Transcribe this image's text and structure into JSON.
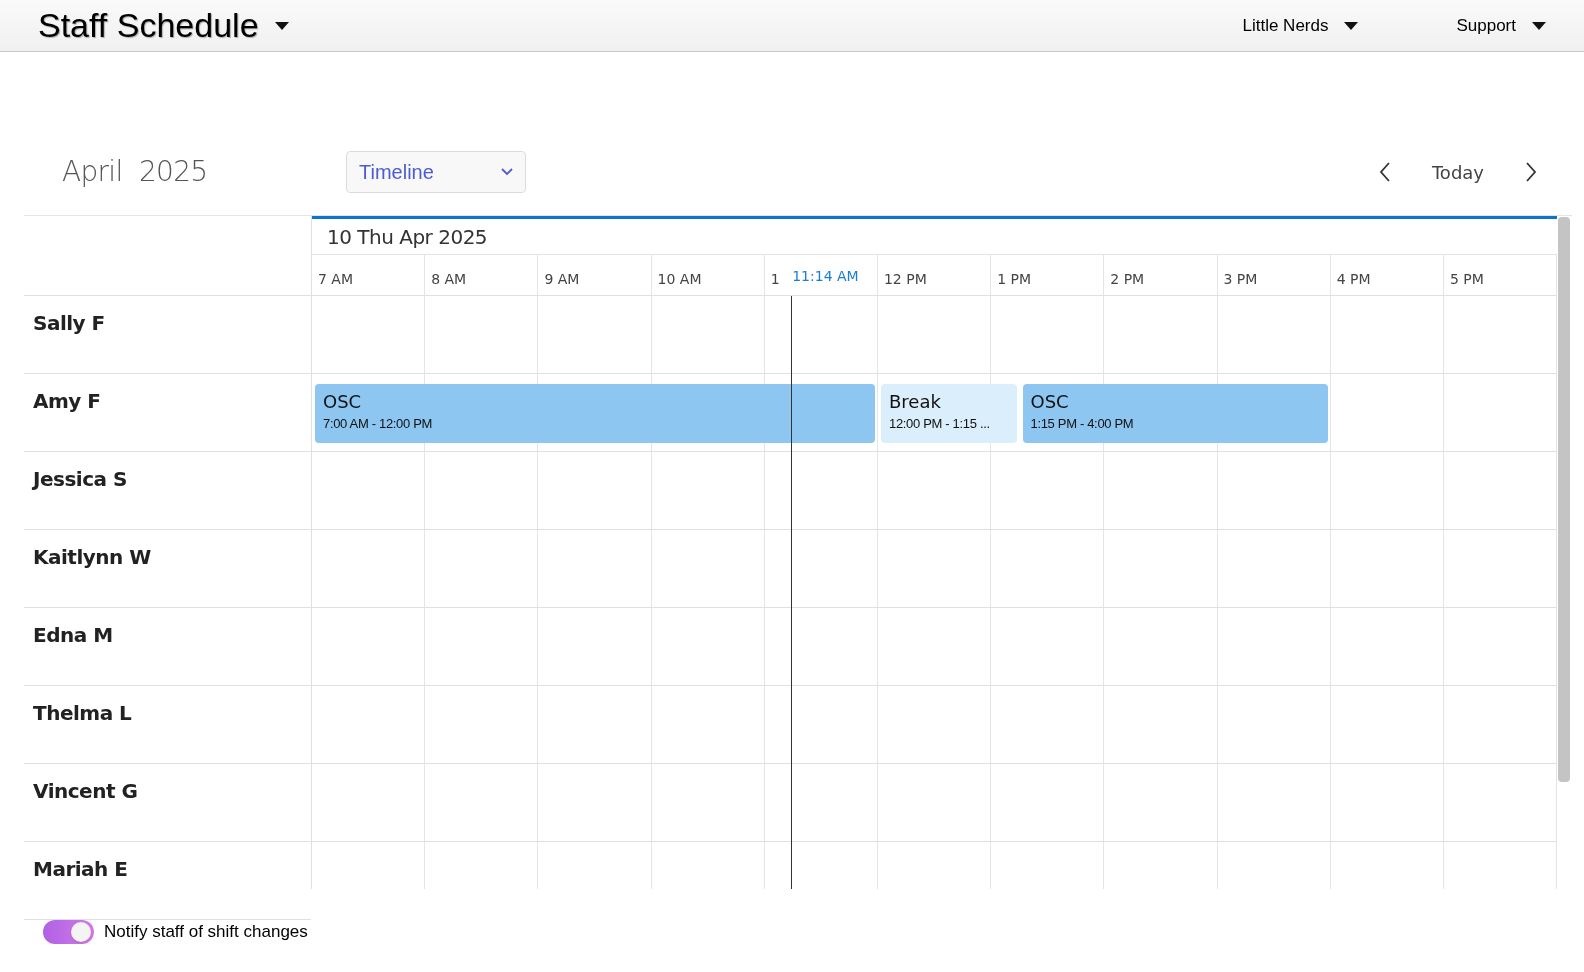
{
  "header": {
    "title": "Staff Schedule",
    "menus": [
      {
        "label": "Little Nerds"
      },
      {
        "label": "Support"
      }
    ]
  },
  "toolbar": {
    "month": "April",
    "year": "2025",
    "view": "Timeline",
    "today": "Today"
  },
  "timeline": {
    "date": "10 Thu Apr 2025",
    "hours": [
      "7 AM",
      "8 AM",
      "9 AM",
      "10 AM",
      "1",
      "12 PM",
      "1 PM",
      "2 PM",
      "3 PM",
      "4 PM",
      "5 PM"
    ],
    "current_time": "11:14 AM",
    "staff": [
      {
        "name": "Sally F"
      },
      {
        "name": "Amy F",
        "events": [
          {
            "title": "OSC",
            "time": "7:00 AM - 12:00 PM",
            "kind": "shift"
          },
          {
            "title": "Break",
            "time": "12:00 PM - 1:15 ...",
            "kind": "break"
          },
          {
            "title": "OSC",
            "time": "1:15 PM - 4:00 PM",
            "kind": "shift"
          }
        ]
      },
      {
        "name": "Jessica S"
      },
      {
        "name": "Kaitlynn W"
      },
      {
        "name": "Edna M"
      },
      {
        "name": "Thelma L"
      },
      {
        "name": "Vincent G"
      },
      {
        "name": "Mariah E"
      }
    ]
  },
  "notify": {
    "label": "Notify staff of shift changes",
    "on": true
  }
}
